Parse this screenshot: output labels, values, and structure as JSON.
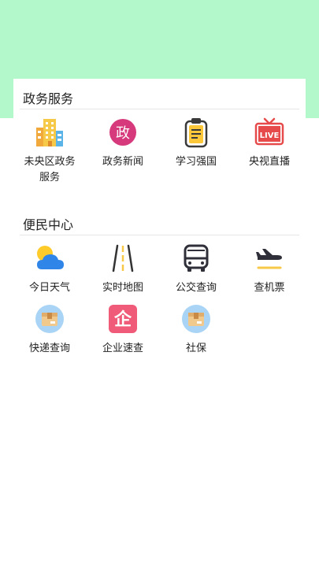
{
  "gov_section": {
    "title": "政务服务",
    "items": [
      {
        "label": "未央区政务服务",
        "icon": "office-building-icon"
      },
      {
        "label": "政务新闻",
        "icon": "government-badge-icon"
      },
      {
        "label": "学习强国",
        "icon": "clipboard-icon"
      },
      {
        "label": "央视直播",
        "icon": "live-tv-icon"
      }
    ]
  },
  "life_section": {
    "title": "便民中心",
    "items": [
      {
        "label": "今日天气",
        "icon": "weather-icon"
      },
      {
        "label": "实时地图",
        "icon": "road-map-icon"
      },
      {
        "label": "公交查询",
        "icon": "bus-icon"
      },
      {
        "label": "查机票",
        "icon": "airplane-icon"
      },
      {
        "label": "快递查询",
        "icon": "package-icon"
      },
      {
        "label": "企业速查",
        "icon": "enterprise-icon"
      },
      {
        "label": "社保",
        "icon": "social-security-package-icon"
      }
    ]
  },
  "colors": {
    "header_band": "#b3f8cb",
    "gov_badge": "#d63a7c",
    "live_red": "#e64a4a",
    "enterprise": "#ef5b78",
    "weather_blue": "#2f86e8",
    "sun_yellow": "#ffcb2b"
  }
}
